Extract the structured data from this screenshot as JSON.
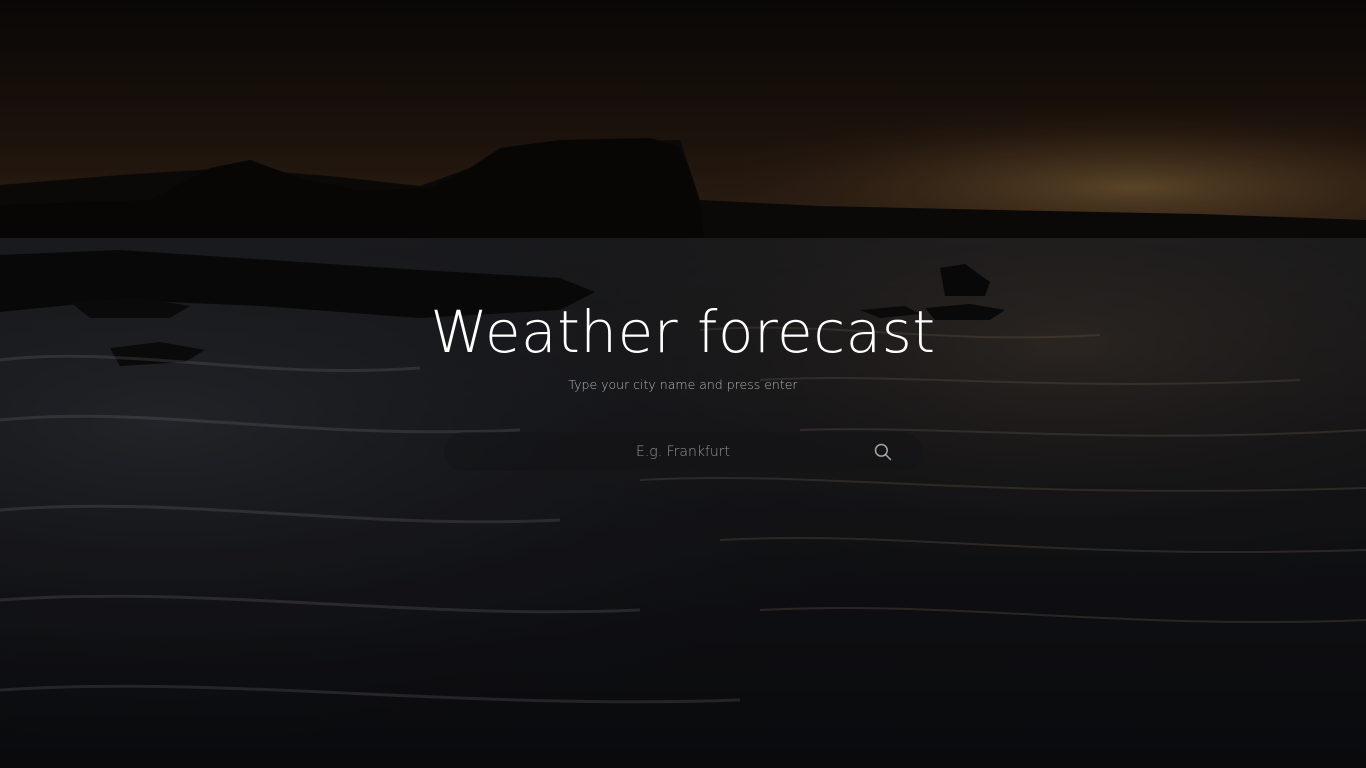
{
  "page": {
    "title": "Weather forecast",
    "subtitle": "Type your city name and press enter"
  },
  "search": {
    "placeholder": "E.g. Frankfurt",
    "value": "",
    "icon": "search-icon"
  },
  "background": {
    "scene": "ocean-coast-at-dusk",
    "overlay_color": "#000000"
  },
  "colors": {
    "title": "#ffffff",
    "subtitle": "#dcdcdc",
    "search_bg": "#141416",
    "placeholder": "#bebebe"
  }
}
